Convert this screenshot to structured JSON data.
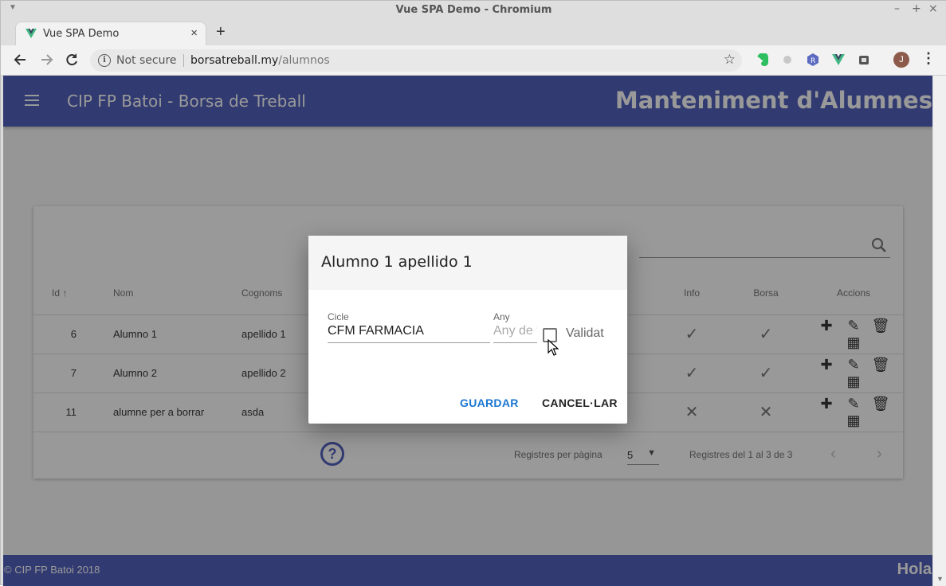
{
  "window": {
    "title": "Vue SPA Demo - Chromium",
    "minimize": "–",
    "maximize": "+",
    "close": "×"
  },
  "tab": {
    "title": "Vue SPA Demo",
    "close": "×",
    "new_tab": "+"
  },
  "toolbar": {
    "not_secure": "Not secure",
    "url_host": "borsatreball.my",
    "url_path": "/alumnos",
    "avatar_letter": "J"
  },
  "app": {
    "title": "CIP FP Batoi - Borsa de Treball",
    "heading": "Manteniment d'Alumnes",
    "footer_copyright": "© CIP FP Batoi 2018",
    "footer_greeting": "Hola"
  },
  "table": {
    "headers": {
      "id": "Id",
      "sort_arrow": "↑",
      "nom": "Nom",
      "cognoms": "Cognoms",
      "info": "Info",
      "borsa": "Borsa",
      "accions": "Accions"
    },
    "rows": [
      {
        "id": "6",
        "nom": "Alumno 1",
        "cognoms": "apellido 1",
        "info": "✓",
        "borsa": "✓"
      },
      {
        "id": "7",
        "nom": "Alumno 2",
        "cognoms": "apellido 2",
        "info": "✓",
        "borsa": "✓"
      },
      {
        "id": "11",
        "nom": "alumne per a borrar",
        "cognoms": "asda",
        "info": "✕",
        "borsa": "✕"
      }
    ],
    "action_icons": [
      "add-icon",
      "edit-icon",
      "delete-icon",
      "calendar-icon"
    ],
    "rows_per_page_label": "Registres per pàgina",
    "rows_per_page_value": "5",
    "range_text": "Registres del 1 al 3 de 3"
  },
  "dialog": {
    "title": "Alumno 1 apellido 1",
    "cicle_label": "Cicle",
    "cicle_value": "CFM FARMACIA",
    "any_label": "Any",
    "any_placeholder": "Any de finalització",
    "validat_label": "Validat",
    "validat_checked": false,
    "save_label": "GUARDAR",
    "cancel_label": "CANCEL·LAR"
  },
  "colors": {
    "primary": "#3f51b5",
    "save_button": "#1976d2"
  }
}
